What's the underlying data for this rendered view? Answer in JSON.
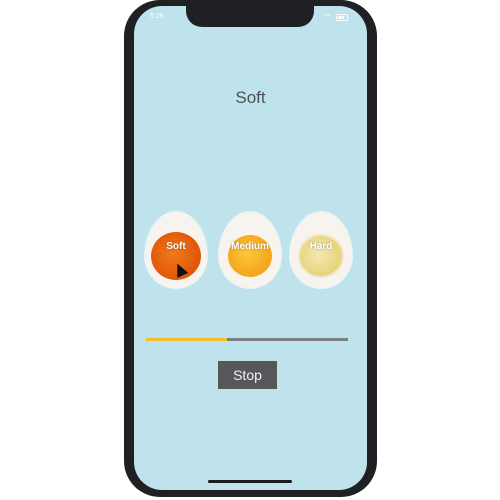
{
  "status_bar": {
    "time": "9:26"
  },
  "header": {
    "title": "Soft"
  },
  "eggs": [
    {
      "label": "Soft"
    },
    {
      "label": "Medium"
    },
    {
      "label": "Hard"
    }
  ],
  "progress": {
    "fraction": 0.4
  },
  "buttons": {
    "stop_label": "Stop"
  },
  "colors": {
    "background": "#bfe3ec",
    "progress_fill": "#f0c12d",
    "progress_track": "#7a7f86",
    "button": "#55575b"
  }
}
